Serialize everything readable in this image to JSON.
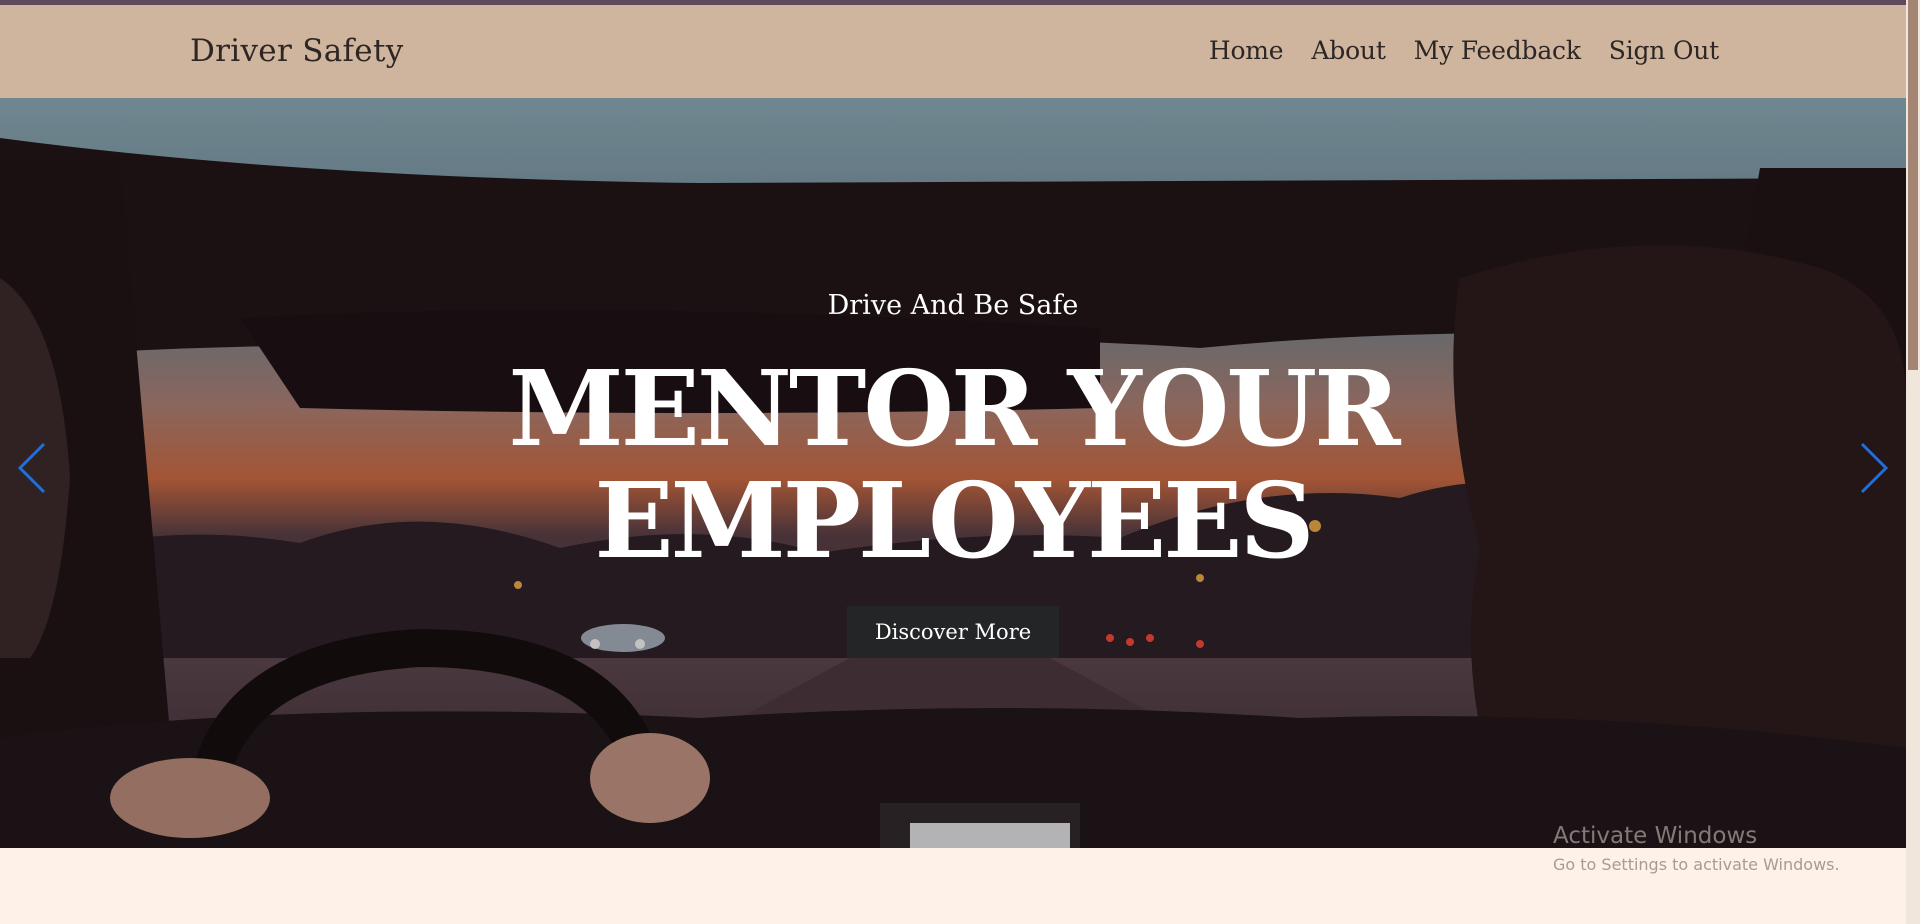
{
  "brand": "Driver Safety",
  "nav": {
    "items": [
      {
        "id": "home",
        "label": "Home"
      },
      {
        "id": "about",
        "label": "About"
      },
      {
        "id": "feedback",
        "label": "My Feedback"
      },
      {
        "id": "signout",
        "label": "Sign Out"
      }
    ]
  },
  "hero": {
    "subtitle": "Drive And Be Safe",
    "title_line1": "MENTOR YOUR",
    "title_line2": "EMPLOYEES",
    "button_label": "Discover More",
    "prev_icon": "chevron-left-icon",
    "next_icon": "chevron-right-icon"
  },
  "watermark": {
    "title": "Activate Windows",
    "subtitle": "Go to Settings to activate Windows."
  },
  "colors": {
    "navbar": "#cfb59e",
    "accent_bar": "#5e4a5a",
    "page_bg": "#fdf1e8",
    "button_bg": "#232526",
    "carousel_arrow": "#1e6fd9"
  }
}
